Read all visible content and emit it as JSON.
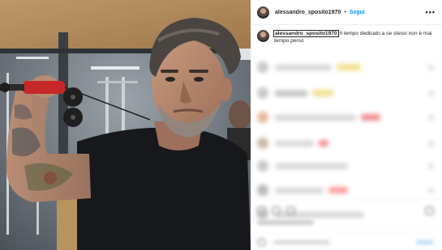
{
  "post": {
    "username": "alessandro_sposito1970",
    "separator": "•",
    "follow_label": "Segui",
    "more_icon": "more-horizontal-icon",
    "caption_username": "alessandro_sposito1970",
    "caption_text": "Il tempo dedicato a se stessi non è mai tempo perso"
  },
  "photo": {
    "subject": "man-in-gym-photo"
  },
  "colors": {
    "follow_blue": "#0095f6",
    "text": "#262626",
    "divider": "#efefef"
  }
}
